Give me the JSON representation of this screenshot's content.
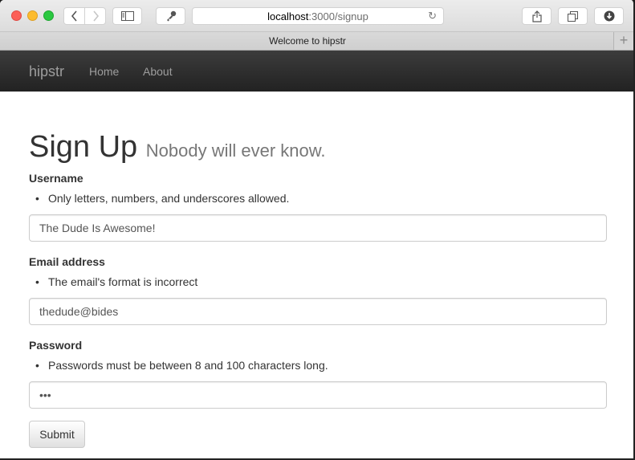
{
  "browser": {
    "address": {
      "host": "localhost",
      "path": ":3000/signup"
    },
    "tab_title": "Welcome to hipstr",
    "icons": {
      "back": "chevron-left-icon",
      "forward": "chevron-right-icon",
      "sidebar": "sidebar-icon",
      "key": "key-icon",
      "reload": "reload-icon",
      "share": "share-icon",
      "tabs": "tabs-icon",
      "download": "download-icon",
      "add_tab": "plus-icon"
    }
  },
  "navbar": {
    "brand": "hipstr",
    "links": [
      {
        "label": "Home"
      },
      {
        "label": "About"
      }
    ]
  },
  "page": {
    "title": "Sign Up",
    "subtitle": "Nobody will ever know.",
    "fields": [
      {
        "label": "Username",
        "error": "Only letters, numbers, and underscores allowed.",
        "value": "The Dude Is Awesome!",
        "type": "text"
      },
      {
        "label": "Email address",
        "error": "The email's format is incorrect",
        "value": "thedude@bides",
        "type": "text"
      },
      {
        "label": "Password",
        "error": "Passwords must be between 8 and 100 characters long.",
        "value": "abc",
        "type": "password"
      }
    ],
    "submit_label": "Submit"
  },
  "colors": {
    "navbar_bg": "#222222",
    "nav_text": "#9d9d9d",
    "text": "#333333",
    "subtitle": "#777777"
  }
}
